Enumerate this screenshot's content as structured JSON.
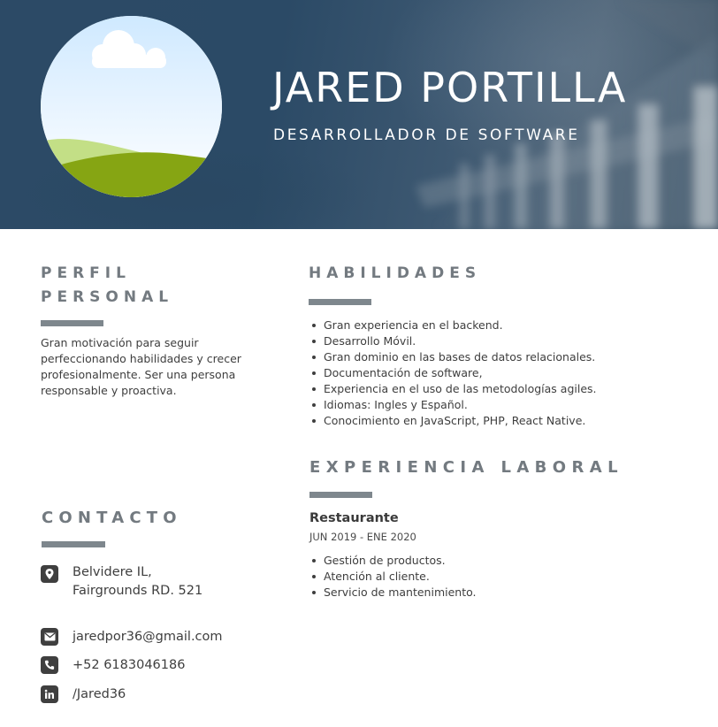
{
  "header": {
    "name": "JARED PORTILLA",
    "role": "DESARROLLADOR DE SOFTWARE"
  },
  "profile": {
    "title_line1": "PERFIL",
    "title_line2": "PERSONAL",
    "text": "Gran motivación para seguir perfeccionando habilidades y crecer profesionalmente. Ser una persona responsable y proactiva."
  },
  "skills": {
    "title": "HABILIDADES",
    "items": [
      "Gran experiencia en el backend.",
      "Desarrollo Móvil.",
      "Gran dominio en las bases de datos relacionales.",
      "Documentación de software,",
      "Experiencia en el uso de las metodologías agiles.",
      "Idiomas: Ingles y Español.",
      "Conocimiento en JavaScript, PHP, React Native."
    ]
  },
  "experience": {
    "title": "EXPERIENCIA LABORAL",
    "job_title": "Restaurante",
    "job_date": "JUN 2019 - ENE 2020",
    "items": [
      "Gestión de productos.",
      "Atención al cliente.",
      "Servicio de mantenimiento."
    ]
  },
  "contact": {
    "title": "CONTACTO",
    "address_line1": "Belvidere IL,",
    "address_line2": "Fairgrounds RD. 521",
    "email": "jaredpor36@gmail.com",
    "phone": "+52 6183046186",
    "linkedin": "/Jared36",
    "icons": [
      "location-icon",
      "email-icon",
      "phone-icon",
      "linkedin-icon"
    ]
  },
  "colors": {
    "header_bg": "#2c4a66",
    "accent_bar": "#7e878d",
    "section_title": "#737a80",
    "icon_bg": "#3f3f3f"
  }
}
